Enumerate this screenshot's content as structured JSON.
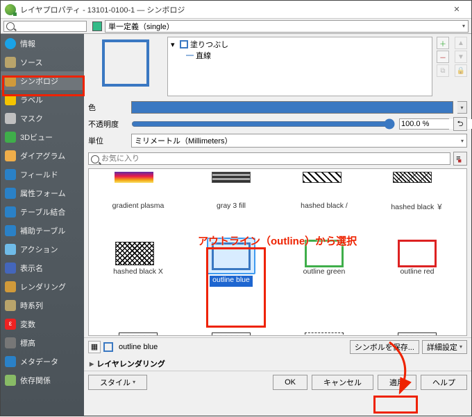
{
  "window": {
    "title": "レイヤプロパティ - 13101-0100-1 — シンボロジ"
  },
  "styletype": {
    "label": "単一定義（single）"
  },
  "sidebar": {
    "items": [
      {
        "label": "情報",
        "icon": "#1aa3e8"
      },
      {
        "label": "ソース",
        "icon": "#b9a46b"
      },
      {
        "label": "シンボロジ",
        "icon": "#d19a3a"
      },
      {
        "label": "ラベル",
        "icon": "#f5c400"
      },
      {
        "label": "マスク",
        "icon": "#c0c0c0"
      },
      {
        "label": "3Dビュー",
        "icon": "#3fae4a"
      },
      {
        "label": "ダイアグラム",
        "icon": "#e07b2c"
      },
      {
        "label": "フィールド",
        "icon": "#2a81c7"
      },
      {
        "label": "属性フォーム",
        "icon": "#2a81c7"
      },
      {
        "label": "テーブル結合",
        "icon": "#2a81c7"
      },
      {
        "label": "補助テーブル",
        "icon": "#2a81c7"
      },
      {
        "label": "アクション",
        "icon": "#6fbbe8"
      },
      {
        "label": "表示名",
        "icon": "#46b"
      },
      {
        "label": "レンダリング",
        "icon": "#d19a3a"
      },
      {
        "label": "時系列",
        "icon": "#b9a46b"
      },
      {
        "label": "変数",
        "icon": "#e22"
      },
      {
        "label": "標高",
        "icon": "#777"
      },
      {
        "label": "メタデータ",
        "icon": "#2a81c7"
      },
      {
        "label": "依存関係",
        "icon": "#8b6"
      }
    ]
  },
  "tree": {
    "root": "塗りつぶし",
    "child": "直線"
  },
  "props": {
    "color_label": "色",
    "color_hex": "#3a78c2",
    "opacity_label": "不透明度",
    "opacity_value": "100.0 %",
    "unit_label": "単位",
    "unit_value": "ミリメートル（Millimeters）"
  },
  "fav": {
    "placeholder": "お気に入り"
  },
  "gallery": {
    "items": [
      {
        "name": "gradient plasma"
      },
      {
        "name": "gray 3 fill"
      },
      {
        "name": "hashed black /"
      },
      {
        "name": "hashed black ￥"
      },
      {
        "name": "hashed black X"
      },
      {
        "name": "outline blue"
      },
      {
        "name": "outline green"
      },
      {
        "name": "outline red"
      }
    ],
    "selected": "outline blue"
  },
  "annotation1": "アウトライン（outline）から選択",
  "result_row": {
    "save": "シンボルを保存...",
    "advanced": "詳細設定"
  },
  "rendering_header": "レイヤレンダリング",
  "buttons": {
    "style": "スタイル",
    "ok": "OK",
    "cancel": "キャンセル",
    "apply": "適用",
    "help": "ヘルプ"
  }
}
